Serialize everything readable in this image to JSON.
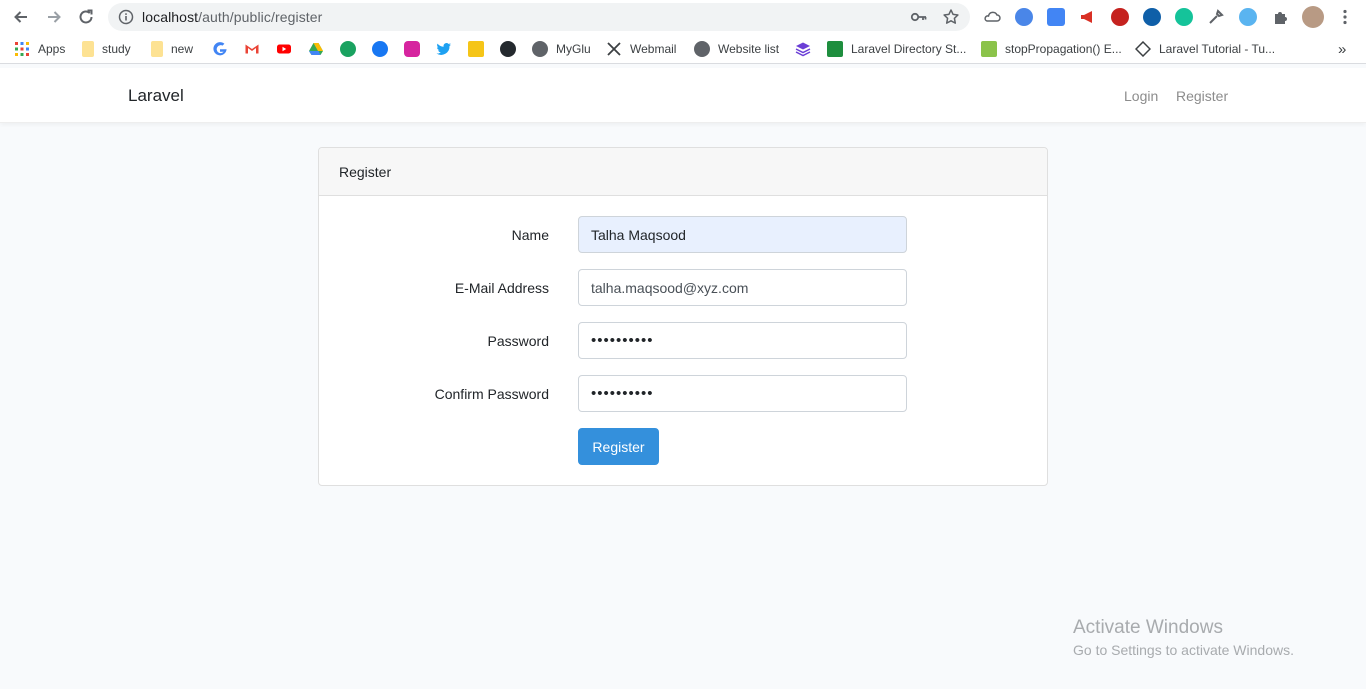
{
  "browser": {
    "url_host": "localhost",
    "url_path": "/auth/public/register",
    "colors": {
      "chrome_bg": "#ffffff",
      "omnibox_bg": "#f1f3f4"
    }
  },
  "bookmarks": {
    "apps": "Apps",
    "study": "study",
    "new": "new",
    "myglu": "MyGlu",
    "webmail": "Webmail",
    "website_list": "Website list",
    "laravel_dir": "Laravel Directory St...",
    "stop_propagation": "stopPropagation() E...",
    "laravel_tutorial": "Laravel Tutorial - Tu...",
    "more": "»"
  },
  "navbar": {
    "brand": "Laravel",
    "login": "Login",
    "register": "Register"
  },
  "card": {
    "title": "Register",
    "name_label": "Name",
    "name_value": "Talha Maqsood",
    "email_label": "E-Mail Address",
    "email_value": "talha.maqsood@xyz.com",
    "password_label": "Password",
    "password_value": "••••••••••",
    "confirm_label": "Confirm Password",
    "confirm_value": "••••••••••",
    "submit": "Register"
  },
  "colors": {
    "primary": "#3490dc",
    "page_bg": "#f8fafc",
    "autofill_bg": "#e8f0fe"
  },
  "watermark": {
    "line1": "Activate Windows",
    "line2": "Go to Settings to activate Windows."
  }
}
